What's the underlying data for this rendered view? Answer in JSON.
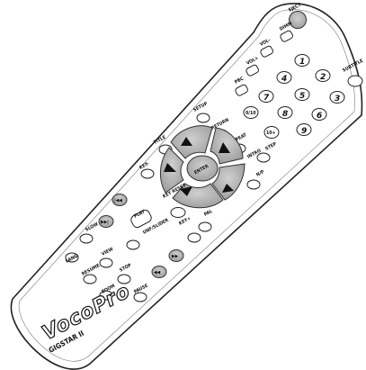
{
  "remote": {
    "brand": "VocoPro",
    "model": "GIGSTAR II"
  },
  "colors": {
    "body": "#ffffff",
    "outline": "#222222",
    "gray_key": "#b3b3b3",
    "dark_key": "#2a2a2a"
  },
  "buttons": {
    "eject": "EJECT",
    "dimmer": "DIMM",
    "vol_minus": "VOL-",
    "vol_plus": "VOL+",
    "pbc": "PBC",
    "subtitle": "SUBTITLE",
    "setup": "SETUP",
    "return": "RETURN",
    "repeat": "REPEAT",
    "intro": "INTRO",
    "step": "STEP",
    "title": "TITLE",
    "key_minus": "KEY-",
    "key_plus": "KEY+",
    "key_reset": "KEY RESET",
    "np": "N/P",
    "enter": "ENTER",
    "play": "PLAY",
    "unf_slider": "UNF/SLIDER",
    "pal": "PAL",
    "slow": "SLOW",
    "lang": "LANG",
    "resume": "RESUME",
    "view": "VIEW",
    "stop": "STOP",
    "zoom": "ZOOM",
    "pause": "PAUSE",
    "num_1": "1",
    "num_2": "2",
    "num_3": "3",
    "num_4": "4",
    "num_5": "5",
    "num_6": "6",
    "num_7": "7",
    "num_8": "8",
    "num_9": "9",
    "num_0": "0",
    "num_10plus": "10+",
    "num_0_10": "0/10"
  },
  "icons": [
    "up-arrow-icon",
    "down-arrow-icon",
    "left-arrow-icon",
    "right-arrow-icon",
    "prev-track-icon",
    "next-track-icon",
    "rewind-icon",
    "fast-forward-icon"
  ]
}
